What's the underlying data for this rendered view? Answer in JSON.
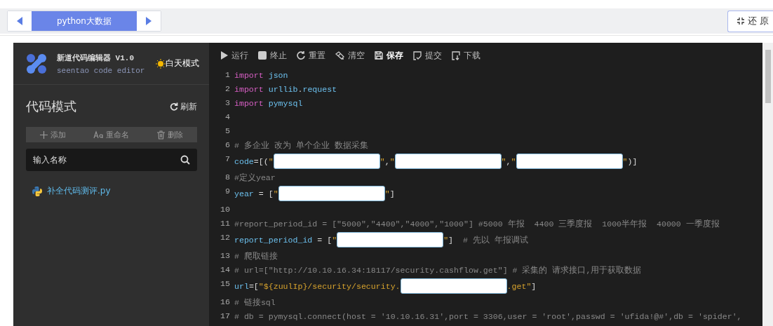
{
  "tabbar": {
    "tabs": [
      {
        "label": "python大数据",
        "selected": true
      }
    ],
    "restore_button": "还 原"
  },
  "sidebar": {
    "app_title": "新道代码编辑器 V1.0",
    "app_subtitle": "seentao code editor",
    "theme_toggle": "白天模式",
    "section_title": "代码模式",
    "refresh": "刷新",
    "actions": [
      {
        "kind": "add",
        "label": "添加"
      },
      {
        "kind": "rename",
        "label": "重命名"
      },
      {
        "kind": "delete",
        "label": "删除"
      }
    ],
    "search": {
      "placeholder": "输入名称"
    },
    "files": [
      {
        "name": "补全代码测评.py"
      }
    ]
  },
  "editor": {
    "toolbar": [
      {
        "kind": "run",
        "label": "运行"
      },
      {
        "kind": "stop",
        "label": "终止"
      },
      {
        "kind": "reset",
        "label": "重置"
      },
      {
        "kind": "clear",
        "label": "清空"
      },
      {
        "kind": "save",
        "label": "保存"
      },
      {
        "kind": "submit",
        "label": "提交"
      },
      {
        "kind": "download",
        "label": "下载"
      }
    ],
    "lines": [
      {
        "number": "1",
        "tokens": [
          {
            "kind": "kw",
            "text": "import"
          },
          {
            "kind": "id",
            "text": " json"
          }
        ]
      },
      {
        "number": "2",
        "tokens": [
          {
            "kind": "kw",
            "text": "import"
          },
          {
            "kind": "id",
            "text": " urllib"
          },
          {
            "kind": "op",
            "text": "."
          },
          {
            "kind": "id",
            "text": "request"
          }
        ]
      },
      {
        "number": "3",
        "tokens": [
          {
            "kind": "kw",
            "text": "import"
          },
          {
            "kind": "id",
            "text": " pymysql"
          }
        ]
      },
      {
        "number": "4"
      },
      {
        "number": "5"
      },
      {
        "number": "6",
        "tokens": [
          {
            "kind": "cm",
            "text": "# 多企业 改为 单个企业 数据采集"
          }
        ]
      },
      {
        "number": "7",
        "tokens": [
          {
            "kind": "id",
            "text": "code"
          },
          {
            "kind": "op",
            "text": "=[("
          },
          {
            "kind": "str",
            "text": "\""
          },
          {
            "kind": "blank"
          },
          {
            "kind": "str",
            "text": "\""
          },
          {
            "kind": "op",
            "text": ","
          },
          {
            "kind": "str",
            "text": "\""
          },
          {
            "kind": "blank"
          },
          {
            "kind": "str",
            "text": "\""
          },
          {
            "kind": "op",
            "text": ","
          },
          {
            "kind": "str",
            "text": "\""
          },
          {
            "kind": "blank"
          },
          {
            "kind": "str",
            "text": "\""
          },
          {
            "kind": "op",
            "text": ")]"
          }
        ]
      },
      {
        "number": "8",
        "tokens": [
          {
            "kind": "cm",
            "text": "#定义year"
          }
        ]
      },
      {
        "number": "9",
        "tokens": [
          {
            "kind": "id",
            "text": "year"
          },
          {
            "kind": "op",
            "text": " = ["
          },
          {
            "kind": "str",
            "text": "\""
          },
          {
            "kind": "blank"
          },
          {
            "kind": "str",
            "text": "\""
          },
          {
            "kind": "op",
            "text": "]"
          }
        ]
      },
      {
        "number": "10"
      },
      {
        "number": "11",
        "tokens": [
          {
            "kind": "cm",
            "text": "#report_period_id = [\"5000\",\"4400\",\"4000\",\"1000\"] #5000 年报  4400 三季度报  1000半年报  40000 一季度报"
          }
        ]
      },
      {
        "number": "12",
        "tokens": [
          {
            "kind": "id",
            "text": "report_period_id"
          },
          {
            "kind": "op",
            "text": " = ["
          },
          {
            "kind": "str",
            "text": "\""
          },
          {
            "kind": "blank"
          },
          {
            "kind": "str",
            "text": "\""
          },
          {
            "kind": "op",
            "text": "]"
          },
          {
            "kind": "cm",
            "text": "  # 先以 年报调试"
          }
        ]
      },
      {
        "number": "13",
        "tokens": [
          {
            "kind": "cm",
            "text": "# 爬取链接"
          }
        ]
      },
      {
        "number": "14",
        "tokens": [
          {
            "kind": "cm",
            "text": "# url=[\"http://10.10.16.34:18117/security.cashflow.get\"] # 采集的 请求接口,用于获取数据"
          }
        ]
      },
      {
        "number": "15",
        "tokens": [
          {
            "kind": "id",
            "text": "url"
          },
          {
            "kind": "op",
            "text": "=["
          },
          {
            "kind": "str",
            "text": "\"${zuulIp}/security/security."
          },
          {
            "kind": "blank"
          },
          {
            "kind": "str",
            "text": ".get\""
          },
          {
            "kind": "op",
            "text": "]"
          }
        ]
      },
      {
        "number": "16",
        "tokens": [
          {
            "kind": "cm",
            "text": "# 链接sql"
          }
        ]
      },
      {
        "number": "17",
        "tokens": [
          {
            "kind": "cm",
            "text": "# db = pymysql.connect(host = '10.10.16.31',port = 3306,user = 'root',passwd = 'ufida!@#',db = 'spider',"
          }
        ]
      }
    ]
  }
}
